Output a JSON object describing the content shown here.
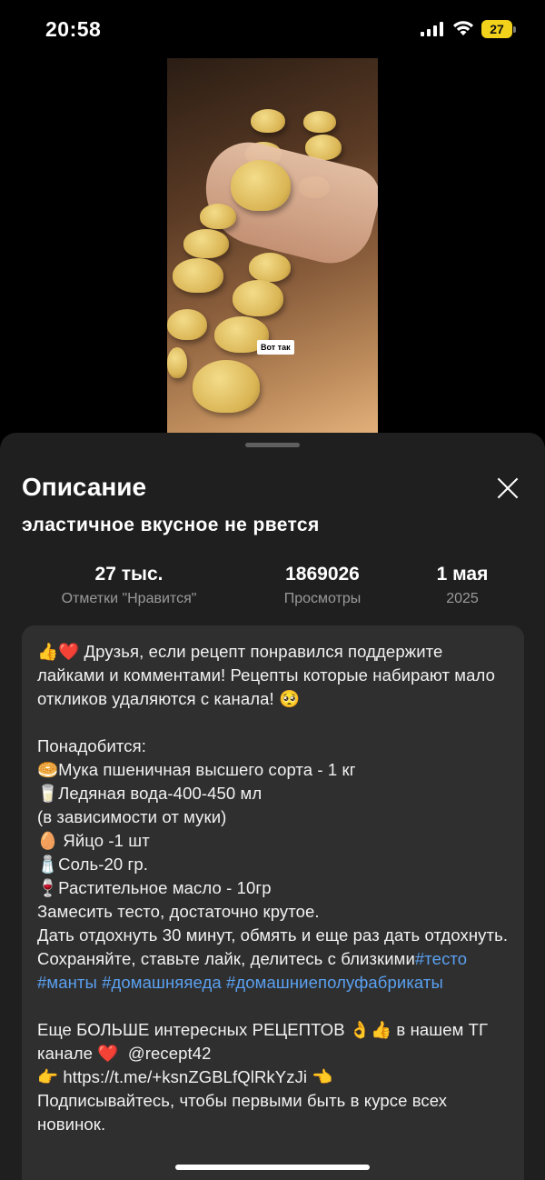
{
  "status_bar": {
    "time": "20:58",
    "battery_level": "27",
    "battery_color": "#f2d21b",
    "icons": [
      "signal-icon",
      "wifi-icon",
      "battery-icon"
    ]
  },
  "video": {
    "caption": "Вот так"
  },
  "sheet": {
    "title": "Описание",
    "subtitle": "эластичное вкусное не рвется",
    "close_icon": "close-icon"
  },
  "stats": {
    "likes_value": "27 тыс.",
    "likes_label": "Отметки \"Нравится\"",
    "views_value": "1869026",
    "views_label": "Просмотры",
    "date_value": "1 мая",
    "date_label": "2025"
  },
  "description": {
    "intro": "👍❤️ Друзья, если рецепт понравился поддержите лайками и комментами! Рецепты которые набирают мало откликов удаляются с канала! 🥺\n\nПонадобится:\n🥯Мука пшеничная высшего сорта - 1 кг\n🥛Ледяная вода-400-450 мл\n(в зависимости от муки)\n🥚 Яйцо -1 шт\n🧂Соль-20 гр.\n🍷Растительное масло - 10гр\nЗамесить тесто, достаточно крутое.\nДать отдохнуть 30 минут, обмять и еще раз дать отдохнуть.\nСохраняйте, ставьте лайк, делитесь с близкими",
    "hashtags": "#тесто #манты #домашняяеда #домашниеполуфабрикаты",
    "outro": "\n\nЕще БОЛЬШЕ интересных РЕЦЕПТОВ 👌👍 в нашем ТГ канале ❤️  @recept42\n👉 https://t.me/+ksnZGBLfQlRkYzJi 👈\nПодписывайтесь, чтобы первыми быть в курсе всех новинок."
  },
  "colors": {
    "sheet_bg": "#1f1f1f",
    "card_bg": "#2f2f2f",
    "hashtag": "#5aa0f0"
  }
}
